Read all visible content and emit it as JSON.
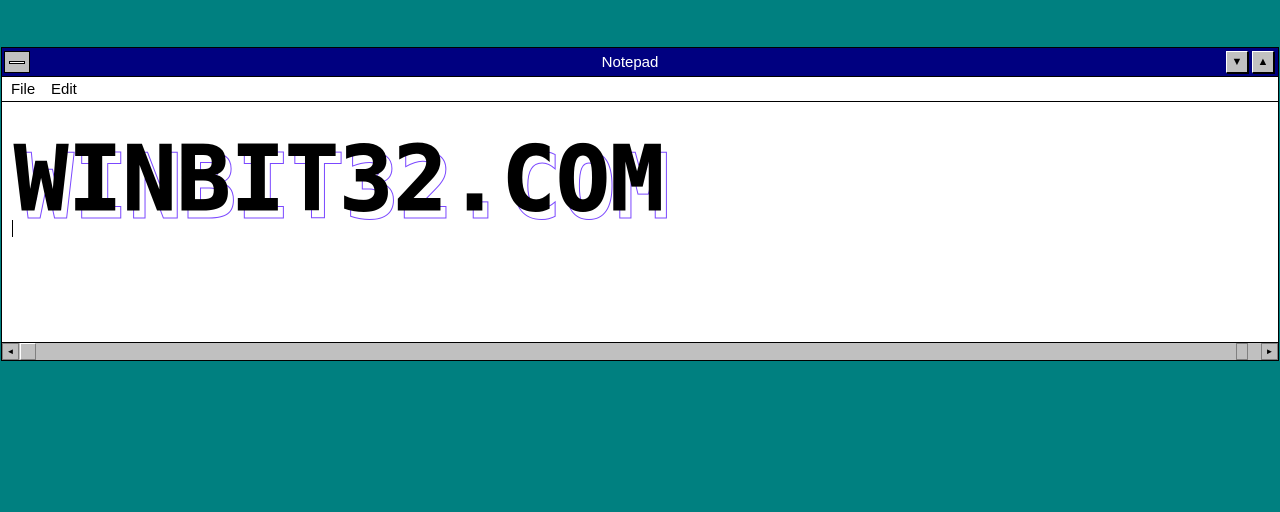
{
  "window": {
    "title": "Notepad"
  },
  "menu": {
    "file": "File",
    "edit": "Edit"
  },
  "editor": {
    "text": "WINBIT32.COM"
  },
  "titlebar_buttons": {
    "minimize": "▼",
    "maximize": "▲"
  },
  "scrollbar": {
    "left": "◄",
    "right": "►"
  },
  "colors": {
    "desktop": "#008080",
    "titlebar": "#000080",
    "chrome": "#c0c0c0"
  }
}
